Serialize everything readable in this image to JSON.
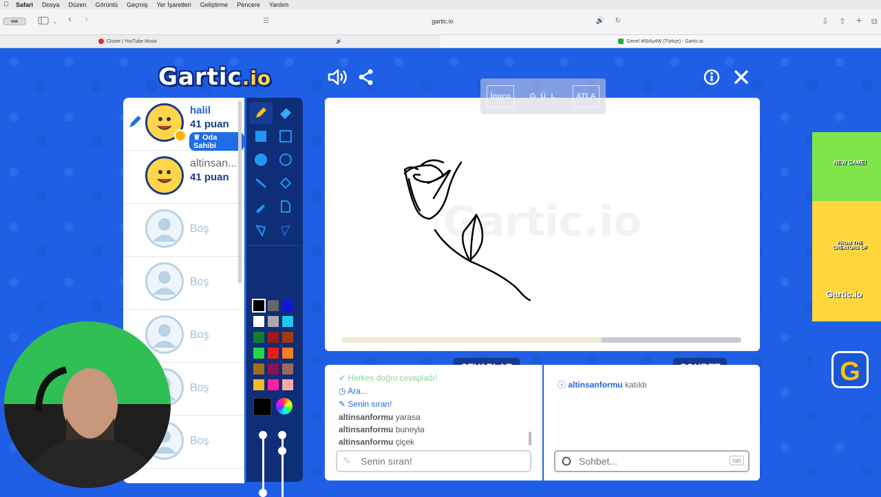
{
  "menubar": {
    "items": [
      "Safari",
      "Dosya",
      "Düzen",
      "Görüntü",
      "Geçmiş",
      "Yer İşaretleri",
      "Geliştirme",
      "Pencere",
      "Yardım"
    ]
  },
  "browser": {
    "url": "gartic.io",
    "tabs": [
      {
        "title": "Closer | YouTube Music",
        "active": false
      },
      {
        "title": "Genel #69Ay4W (Türkçe) - Gartic.io",
        "active": true
      }
    ]
  },
  "game": {
    "logo_main": "Gartic",
    "logo_suffix": ".io",
    "players": [
      {
        "name": "halil",
        "points": "41 puan",
        "badge": "Oda Sahibi",
        "drawing": true
      },
      {
        "name": "altinsan...",
        "points": "41 puan"
      },
      {
        "empty": "Boş"
      },
      {
        "empty": "Boş"
      },
      {
        "empty": "Boş"
      },
      {
        "empty": "Boş"
      },
      {
        "empty": "Boş"
      }
    ],
    "hint_buttons": [
      "İpucu",
      "G Ü L",
      "ATLA"
    ],
    "timer_progress": 0.65,
    "answers_header": "CEVAPLAR",
    "chat_header": "SOHBET",
    "answer_messages": [
      {
        "text": "Herkes doğru cevapladı!"
      },
      {
        "text": "Ara..."
      },
      {
        "text": "Senin sıran!"
      },
      {
        "user": "altinsanformu",
        "text": "yarasa"
      },
      {
        "user": "altinsanformu",
        "text": "buneyla"
      },
      {
        "user": "altinsanformu",
        "text": "çiçek"
      }
    ],
    "chat_messages": [
      {
        "user": "altinsanformu",
        "text": "katıldı"
      }
    ],
    "answer_placeholder": "Senin sıran!",
    "chat_placeholder": "Sohbet...",
    "chat_key_hint": "tab",
    "colors": [
      "#000000",
      "#666666",
      "#1414d8",
      "#ffffff",
      "#aaaaaa",
      "#22c8f0",
      "#137d2d",
      "#9c1a1a",
      "#a33a12",
      "#22d645",
      "#e81b1b",
      "#ff7d22",
      "#a66a1c",
      "#8a1452",
      "#9a6a5e",
      "#f5b92a",
      "#ff1fa0",
      "#ffa8a8"
    ],
    "ad_texts": [
      "NEW GAME!",
      "FROM THE CREATORS OF",
      "Gartic.io"
    ]
  }
}
